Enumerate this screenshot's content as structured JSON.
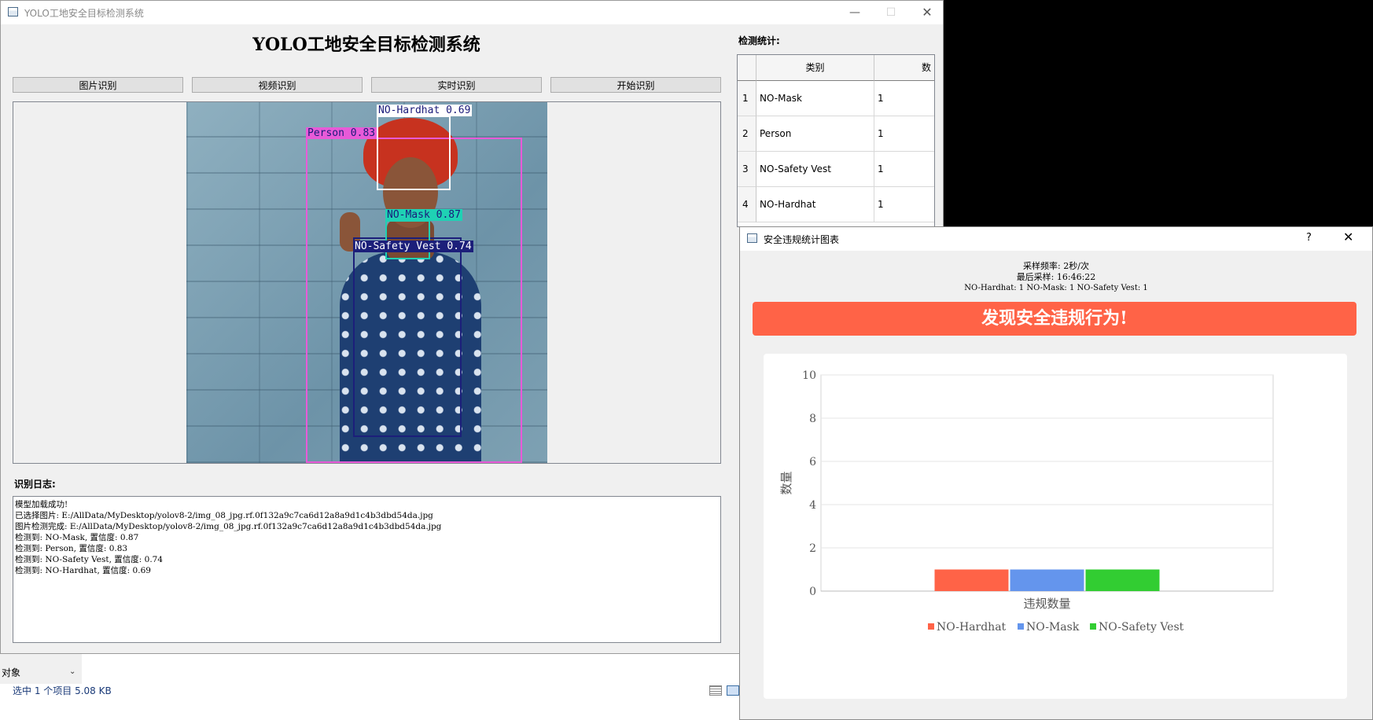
{
  "explorer": {
    "object_label": "对象",
    "status": "选中 1 个项目  5.08 KB"
  },
  "main_window": {
    "title": "YOLO工地安全目标检测系统",
    "heading": "YOLO工地安全目标检测系统",
    "buttons": {
      "image": "图片识别",
      "video": "视频识别",
      "realtime": "实时识别",
      "start": "开始识别"
    },
    "detections": [
      {
        "label": "NO-Hardhat 0.69",
        "color": "#ffffff",
        "text_color": "#1a1a7a"
      },
      {
        "label": "Person 0.83",
        "color": "#e85ad8",
        "text_color": "#1a1a7a"
      },
      {
        "label": "NO-Mask 0.87",
        "color": "#1fd1b4",
        "text_color": "#1a1a7a"
      },
      {
        "label": "NO-Safety Vest 0.74",
        "color": "#1c1f7a",
        "text_color": "#ffffff"
      }
    ],
    "log_heading": "识别日志:",
    "log_lines": [
      "模型加载成功!",
      "已选择图片: E:/AllData/MyDesktop/yolov8-2/img_08_jpg.rf.0f132a9c7ca6d12a8a9d1c4b3dbd54da.jpg",
      "图片检测完成: E:/AllData/MyDesktop/yolov8-2/img_08_jpg.rf.0f132a9c7ca6d12a8a9d1c4b3dbd54da.jpg",
      "检测到: NO-Mask, 置信度: 0.87",
      "检测到: Person, 置信度: 0.83",
      "检测到: NO-Safety Vest, 置信度: 0.74",
      "检测到: NO-Hardhat, 置信度: 0.69"
    ],
    "stats_heading": "检测统计:",
    "stats_table": {
      "headers": [
        "类别",
        "数"
      ],
      "rows": [
        {
          "index": "1",
          "category": "NO-Mask",
          "count": "1"
        },
        {
          "index": "2",
          "category": "Person",
          "count": "1"
        },
        {
          "index": "3",
          "category": "NO-Safety Vest",
          "count": "1"
        },
        {
          "index": "4",
          "category": "NO-Hardhat",
          "count": "1"
        }
      ]
    }
  },
  "chart_dialog": {
    "title": "安全违规统计图表",
    "help": "?",
    "sample_rate": "采样频率: 2秒/次",
    "last_sample": "最后采样: 16:46:22",
    "summary": "NO-Hardhat: 1  NO-Mask: 1  NO-Safety Vest: 1",
    "alert": "发现安全违规行为!"
  },
  "chart_data": {
    "type": "bar",
    "categories": [
      "违规数量"
    ],
    "series": [
      {
        "name": "NO-Hardhat",
        "values": [
          1
        ],
        "color": "#ff6347"
      },
      {
        "name": "NO-Mask",
        "values": [
          1
        ],
        "color": "#6495ed"
      },
      {
        "name": "NO-Safety Vest",
        "values": [
          1
        ],
        "color": "#32cd32"
      }
    ],
    "xlabel": "违规数量",
    "ylabel": "数量",
    "ylim": [
      0,
      10
    ],
    "yticks": [
      "0",
      "2",
      "4",
      "6",
      "8",
      "10"
    ],
    "grid": true,
    "legend": "bottom"
  }
}
